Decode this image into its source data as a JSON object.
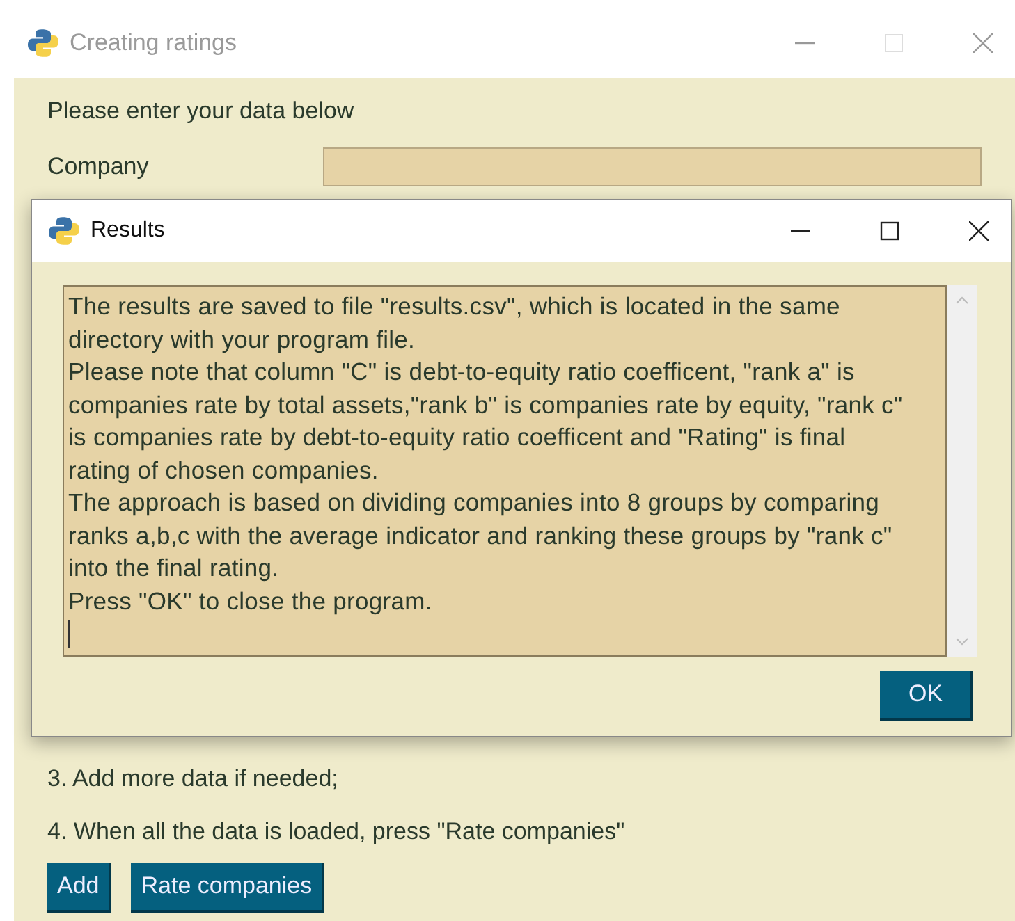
{
  "window": {
    "title": "Creating ratings",
    "active": false
  },
  "form": {
    "heading": "Please enter your data below",
    "company_label": "Company"
  },
  "steps": [
    "3. Add more data if needed;",
    "4. When all the data is loaded, press \"Rate companies\""
  ],
  "buttons": [
    "Add",
    "Rate companies"
  ],
  "dialog": {
    "title": "Results",
    "active": true,
    "paragraphs": [
      "The results are saved to file \"results.csv\", which is located in the same directory with your program file.",
      "Please note that column \"C\" is debt-to-equity ratio coefficent, \"rank a\" is companies rate by total assets,\"rank b\" is companies rate by equity, \"rank c\" is companies rate by debt-to-equity ratio coefficent and \"Rating\" is final rating of chosen companies.",
      "The approach is based on dividing companies into 8 groups by comparing ranks a,b,c with the average indicator and ranking these groups by \"rank c\" into the final rating.",
      "Press \"OK\" to close the program."
    ],
    "button": "OK"
  }
}
